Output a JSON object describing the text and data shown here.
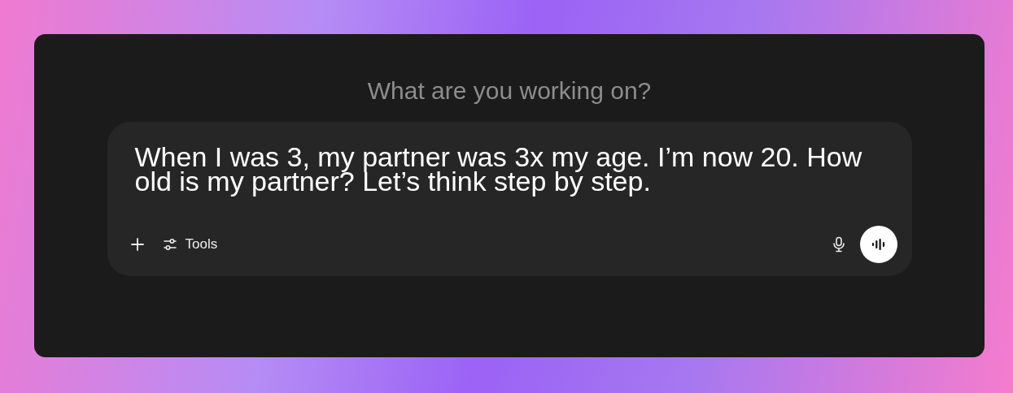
{
  "heading": "What are you working on?",
  "prompt": {
    "value": "When I was 3, my partner was 3x my age. I’m now 20. How old is my partner? Let’s think step by step."
  },
  "toolbar": {
    "tools_label": "Tools"
  }
}
